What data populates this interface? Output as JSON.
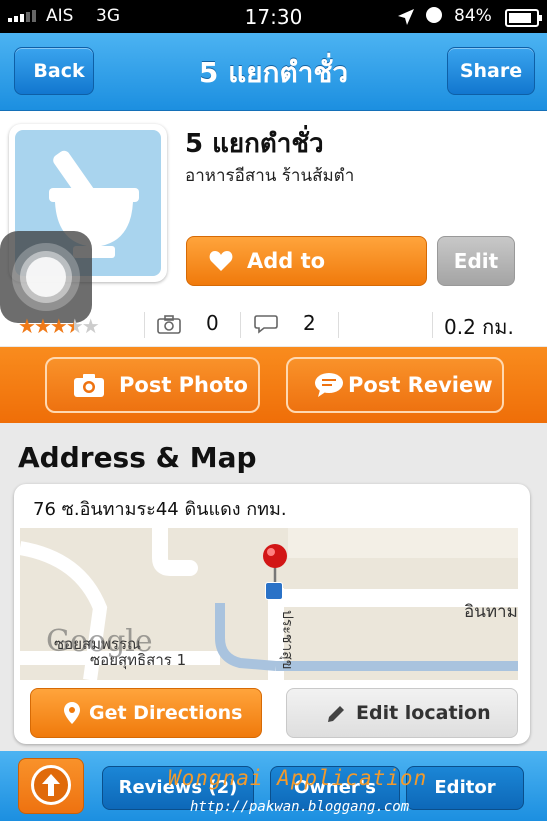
{
  "status_bar": {
    "carrier": "AIS",
    "network": "3G",
    "time": "17:30",
    "battery": "84%"
  },
  "nav": {
    "back_label": "Back",
    "title": "5 แยกตำชั่ว",
    "share_label": "Share"
  },
  "place": {
    "name": "5 แยกตำชั่ว",
    "category": "อาหารอีสาน ร้านส้มตำ",
    "favorite_label": "Add to Favorite",
    "edit_label": "Edit",
    "rating": 3.5,
    "rating_max": 5,
    "photo_count": "0",
    "review_count": "2",
    "distance": "0.2 กม."
  },
  "actions": {
    "post_photo": "Post Photo",
    "post_review": "Post Review"
  },
  "address": {
    "section_title": "Address & Map",
    "text": "76 ซ.อินทามระ44 ดินแดง กทม.",
    "map_labels": {
      "street_right": "อินทาม",
      "street_vertical": "ประชาสุข",
      "street_bottom": "ซอยสุทธิสาร 1",
      "street_bottom_b": "ซอยสมพรรณ",
      "brand": "Google"
    },
    "get_directions": "Get Directions",
    "edit_location": "Edit location"
  },
  "tabs": {
    "reviews": "Reviews (2)",
    "owners": "Owner's",
    "editor": "Editor"
  },
  "watermark": {
    "line1": "Wongnai Application",
    "line2": "http://pakwan.bloggang.com"
  },
  "colors": {
    "nav_blue": "#1c8fe0",
    "accent_orange": "#f07a0c",
    "star_on": "#f07a18"
  }
}
